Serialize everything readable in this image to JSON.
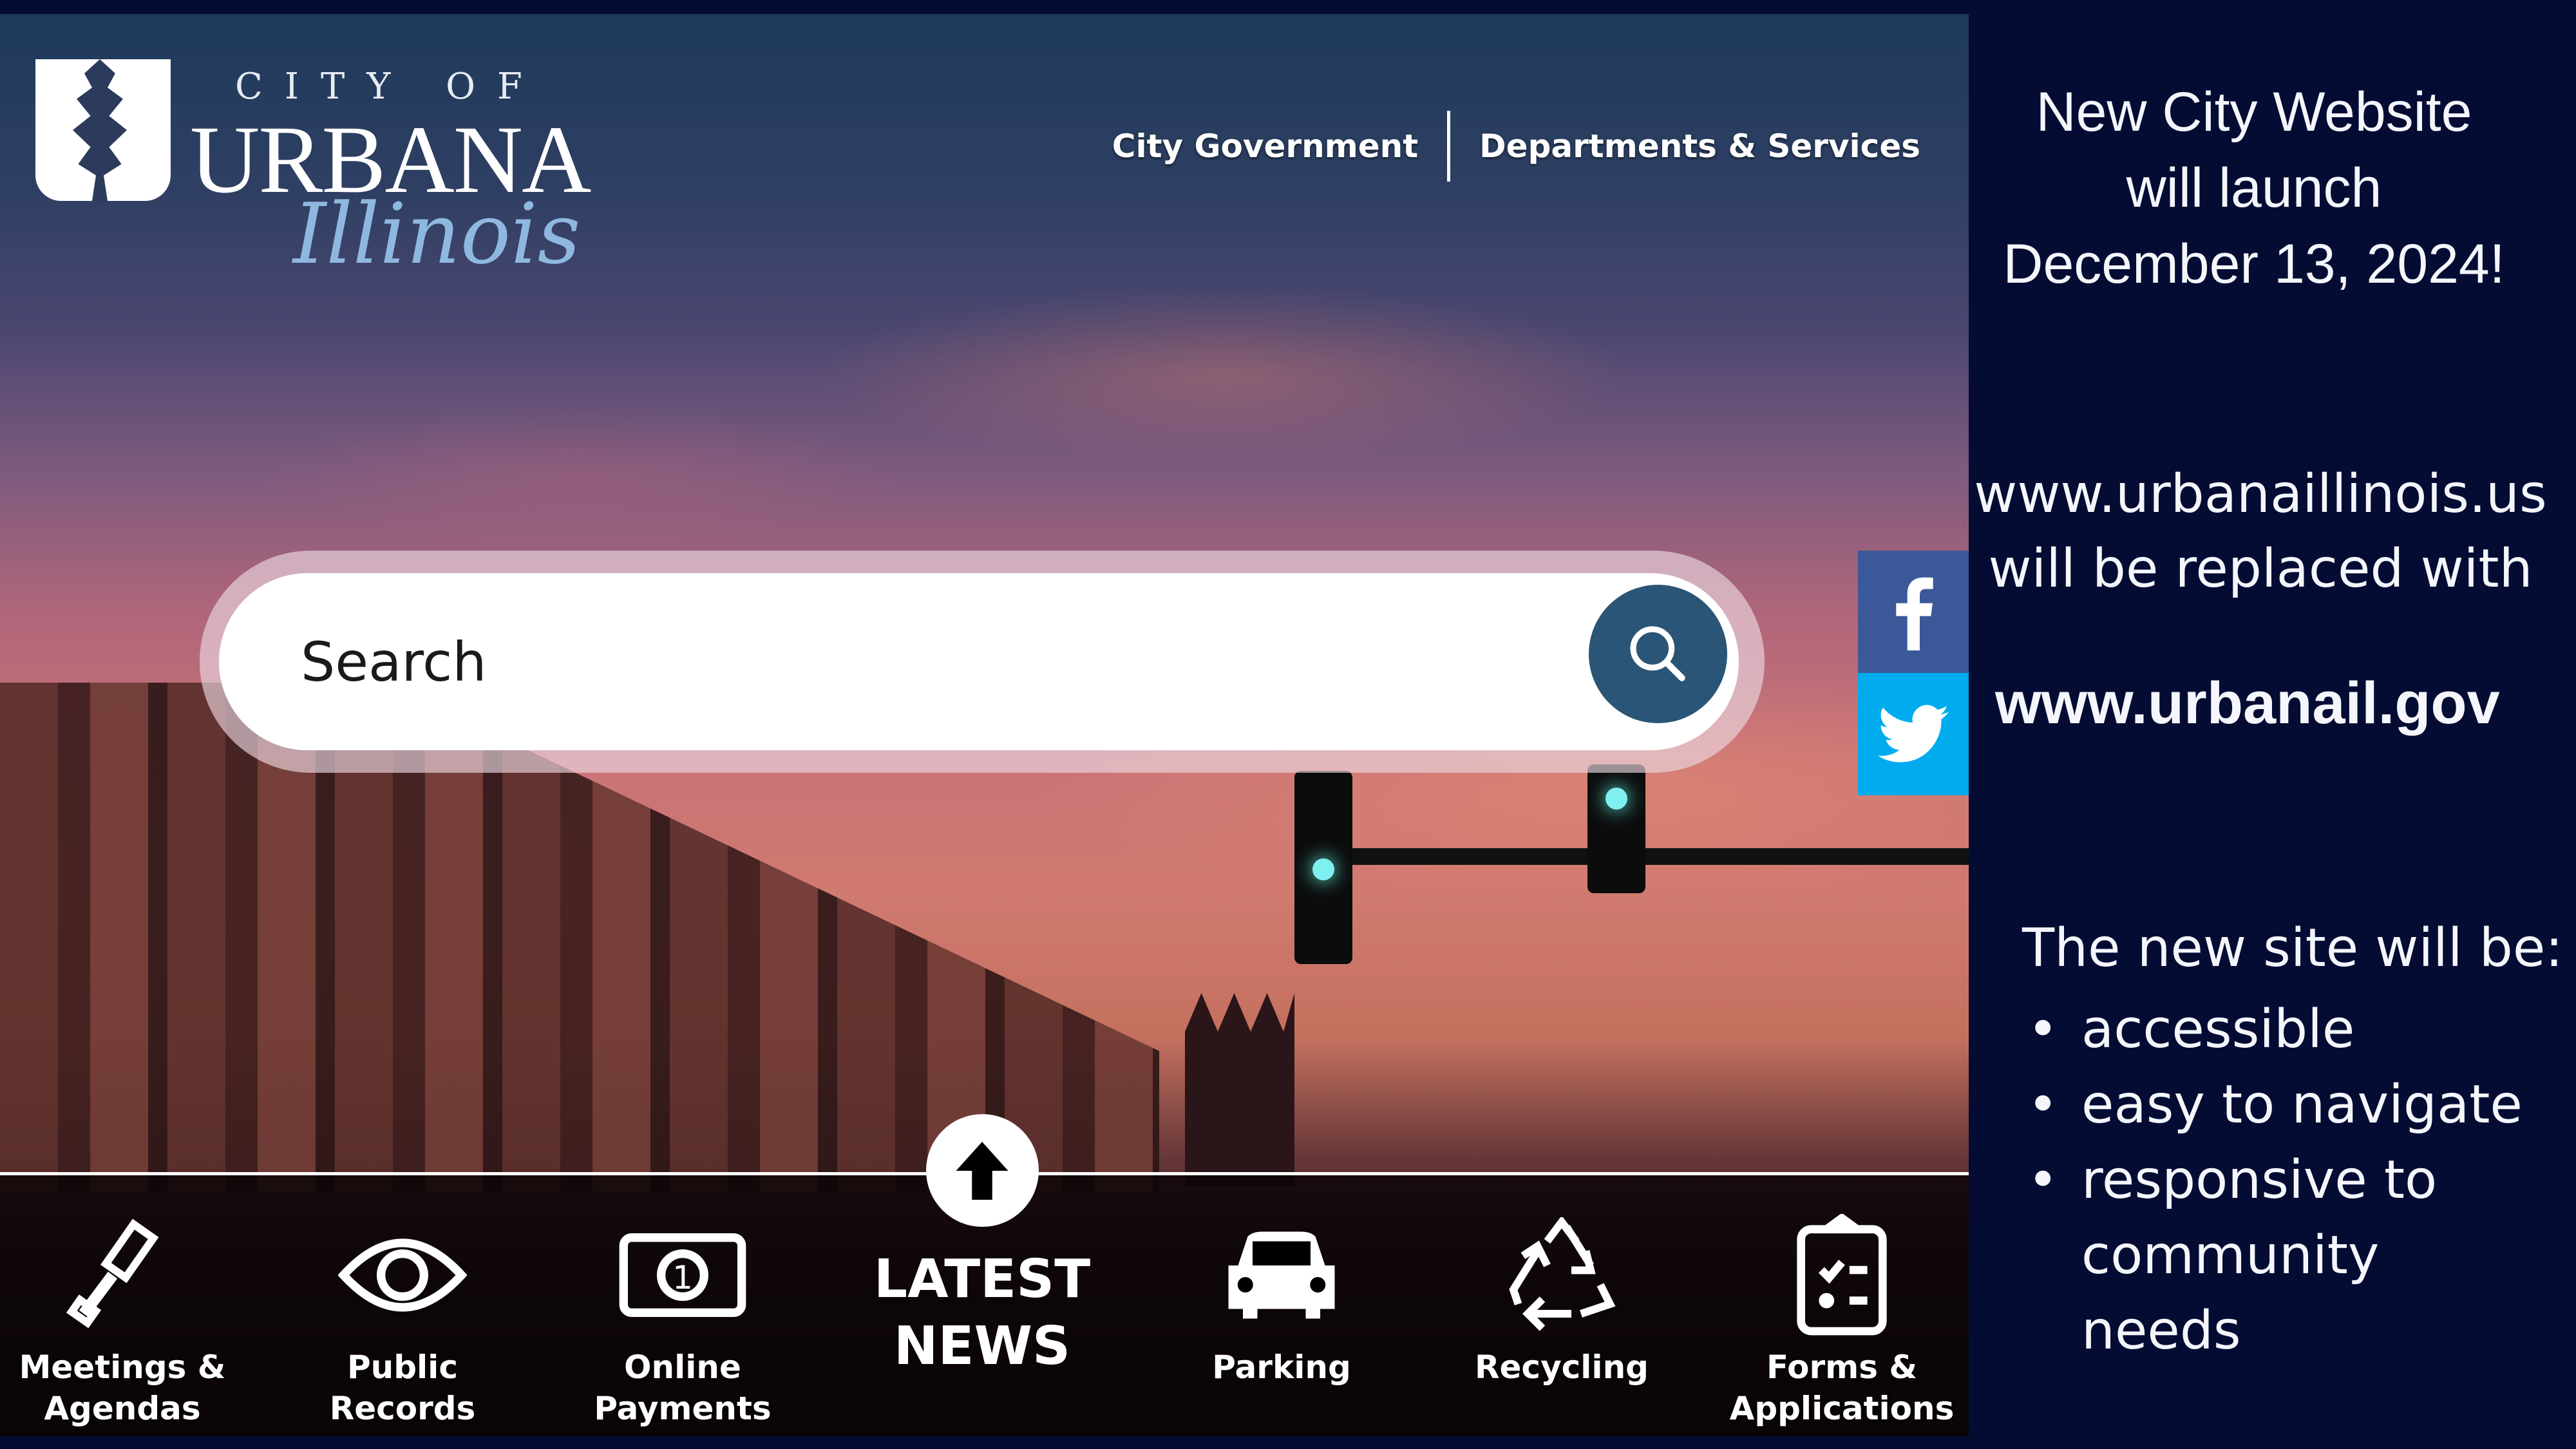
{
  "site": {
    "logo": {
      "line1": "CITY OF",
      "line2": "URBANA",
      "line3": "Illinois"
    },
    "nav": [
      {
        "label": "City Government"
      },
      {
        "label": "Departments & Services"
      }
    ],
    "search": {
      "placeholder": "Search",
      "icon": "search-icon"
    },
    "social": [
      {
        "name": "facebook",
        "icon": "facebook-icon",
        "color": "#3b5998"
      },
      {
        "name": "twitter",
        "icon": "twitter-icon",
        "color": "#00acee"
      }
    ],
    "quicklinks": [
      {
        "label": "Meetings & Agendas",
        "icon": "gavel-icon"
      },
      {
        "label": "Public Records",
        "icon": "eye-icon"
      },
      {
        "label": "Online Payments",
        "icon": "dollar-bill-icon"
      },
      {
        "label": "Parking",
        "icon": "car-icon"
      },
      {
        "label": "Recycling",
        "icon": "recycle-icon"
      },
      {
        "label": "Forms & Applications",
        "icon": "clipboard-icon"
      }
    ],
    "latest_news": {
      "line1": "LATEST",
      "line2": "NEWS",
      "icon": "arrow-up-icon"
    }
  },
  "announcement": {
    "headline": [
      "New City Website",
      "will launch",
      "December 13, 2024!"
    ],
    "old_url_lines": [
      "www.urbanaillinois.us",
      "will be replaced with"
    ],
    "new_url": "www.urbanail.gov",
    "list_heading": "The new site will be:",
    "features": [
      "accessible",
      "easy to navigate",
      "responsive to community needs"
    ],
    "background_color": "#050c33"
  }
}
